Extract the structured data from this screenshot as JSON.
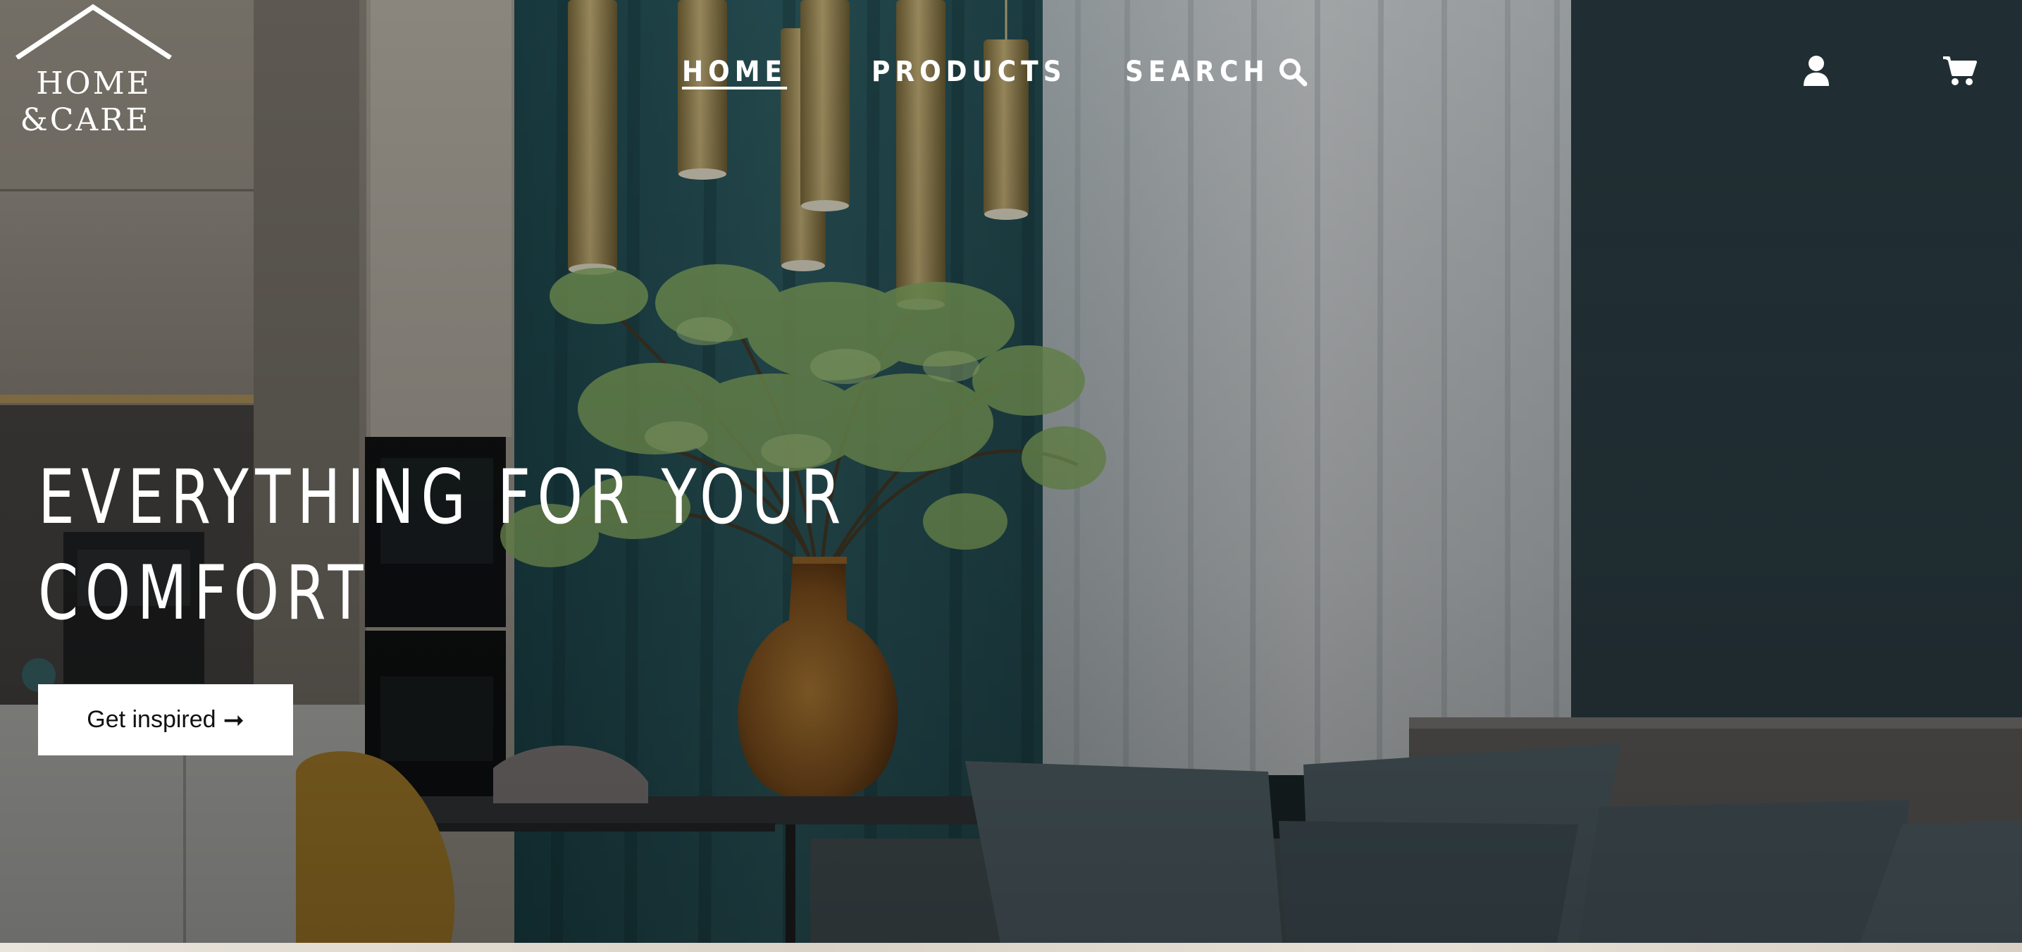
{
  "brand": {
    "line1": "HOME",
    "line2": "&CARE"
  },
  "nav": {
    "home": "HOME",
    "products": "PRODUCTS",
    "search": "SEARCH"
  },
  "hero": {
    "headline_line1": "EVERYTHING FOR YOUR",
    "headline_line2": "COMFORT",
    "cta_label": "Get inspired",
    "cta_arrow": "➞"
  },
  "icons": {
    "logo": "house-roof-icon",
    "search": "magnifier-icon",
    "account": "user-icon",
    "cart": "shopping-cart-icon",
    "cta": "arrow-right-icon"
  },
  "colors": {
    "nav_text": "#ffffff",
    "cta_background": "#ffffff",
    "cta_text": "#111111"
  }
}
